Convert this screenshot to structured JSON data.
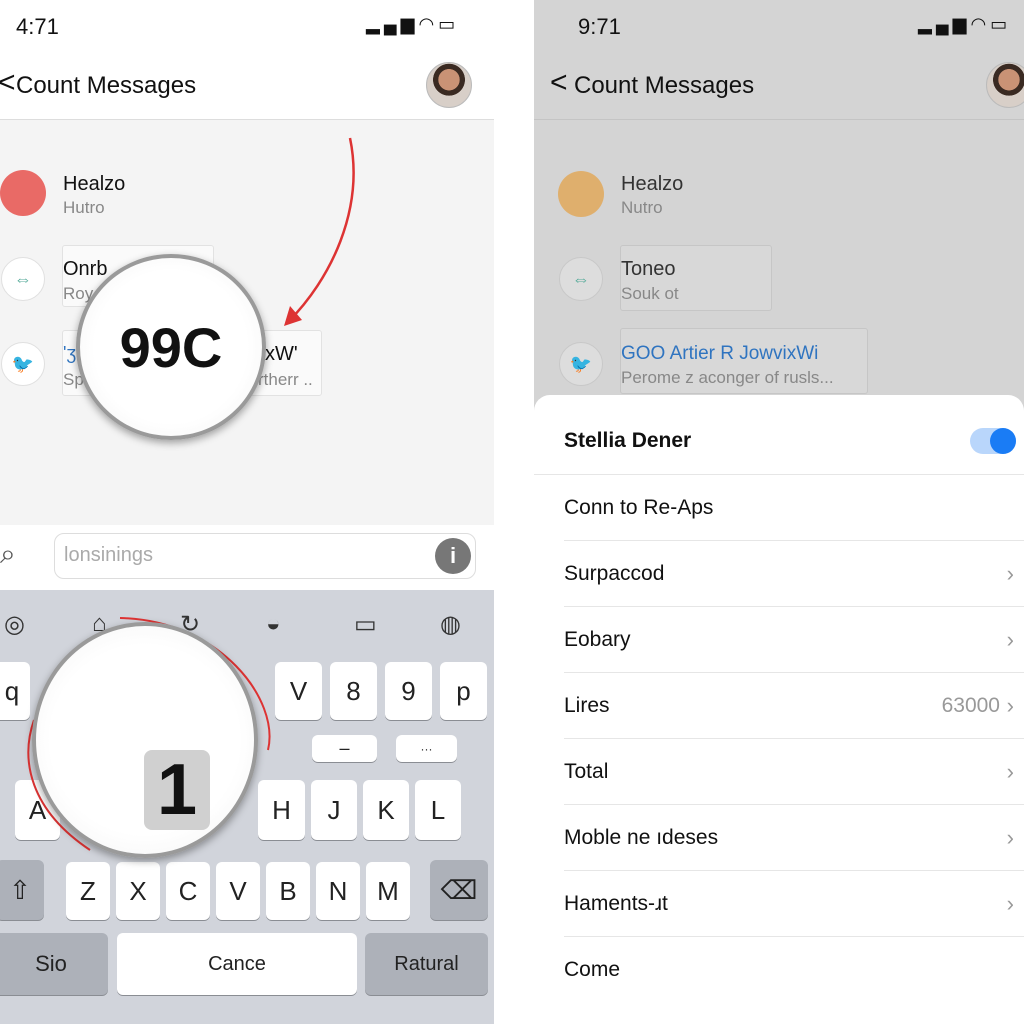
{
  "left": {
    "status": {
      "time": "4:71",
      "icons": "signal wifi battery"
    },
    "header": {
      "back": "<",
      "title": "Count Messages"
    },
    "list": [
      {
        "name": "Healzo",
        "sub": "Hutro",
        "icon": "red-dot",
        "color": "#e96a66"
      },
      {
        "name": "Onrb",
        "sub": "Roy",
        "icon": "contact-icon"
      },
      {
        "name": "'ʒ",
        "sub": "Sp",
        "icon": "twitter-bird-icon",
        "right_name": "xW'",
        "right_sub": "rtherr .."
      }
    ],
    "magnifier_text": "99C",
    "search": {
      "placeholder": "lonsinings",
      "info": "i"
    },
    "keyboard": {
      "row1": [
        "q",
        "V",
        "8",
        "9",
        "p"
      ],
      "row2": [
        "–",
        "···"
      ],
      "row3": [
        "A",
        "H",
        "J",
        "K",
        "L"
      ],
      "row4": [
        "Z",
        "X",
        "C",
        "V",
        "B",
        "N",
        "M"
      ],
      "row5": [
        "Sio",
        "Cance",
        "Ratural"
      ],
      "magnifier_key": "1"
    }
  },
  "right": {
    "status": {
      "time": "9:71"
    },
    "header": {
      "back": "<",
      "title": "Count Messages"
    },
    "list": [
      {
        "name": "Healzo",
        "sub": "Nutro",
        "color": "#e1a85a"
      },
      {
        "name": "Toneo",
        "sub": "Souk ot"
      },
      {
        "name": "GOO Artier R JowvixWi",
        "sub": "Perome z aconger of rusls...",
        "link_color": "#2f74c0"
      }
    ],
    "sheet": {
      "title": "Stellia Dener",
      "toggle_on": true,
      "accent": "#1a7cf5",
      "rows": [
        {
          "label": "Conn to Re-Aps",
          "chevron": false
        },
        {
          "label": "Surpaccod",
          "chevron": true
        },
        {
          "label": "Eobary",
          "chevron": true
        },
        {
          "label": "Lires",
          "value": "63000",
          "chevron": true
        },
        {
          "label": "Total",
          "chevron": true
        },
        {
          "label": "Moble ne ıdeses",
          "chevron": true
        },
        {
          "label": "Haments-ɹt",
          "chevron": true
        },
        {
          "label": "Come",
          "chevron": false
        }
      ]
    }
  }
}
